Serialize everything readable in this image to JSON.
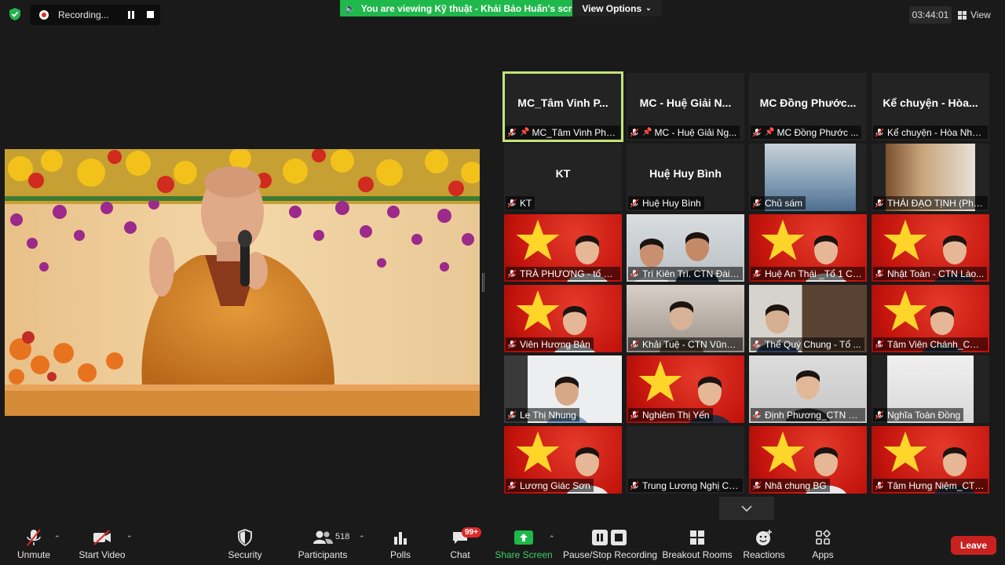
{
  "top": {
    "recording_label": "Recording...",
    "viewing_banner": "You are viewing Kỹ thuật - Khải Bảo Huấn's screen",
    "view_options": "View Options",
    "timer": "03:44:01",
    "view_label": "View"
  },
  "gallery": [
    {
      "big_name": "MC_Tâm Vinh P...",
      "caption": "MC_Tâm Vinh Pho...",
      "pinned": true,
      "active": true,
      "bg": "name"
    },
    {
      "big_name": "MC - Huệ Giải N...",
      "caption": "MC - Huệ Giải Ng...",
      "pinned": true,
      "bg": "name"
    },
    {
      "big_name": "MC Đồng Phước...",
      "caption": "MC Đồng Phước ...",
      "pinned": true,
      "bg": "name"
    },
    {
      "big_name": "Kể chuyện - Hòa...",
      "caption": "Kể chuyện - Hòa Nhã...",
      "bg": "name"
    },
    {
      "big_name": "KT",
      "caption": "KT",
      "bg": "name"
    },
    {
      "big_name": "Huệ Huy Bình",
      "caption": "Huệ Huy Bình",
      "bg": "name"
    },
    {
      "caption": "Chủ sám",
      "bg": "room-blue"
    },
    {
      "caption": "THÁI ĐẠO TỊNH (Phật...",
      "bg": "room-warm"
    },
    {
      "caption": "TRÀ PHƯƠNG - tổ 1 ...",
      "bg": "flag"
    },
    {
      "caption": "Trí Kiên Trì. CTN Đài L...",
      "bg": "office"
    },
    {
      "caption": "Huệ An Thái _Tổ 1 CT...",
      "bg": "flag"
    },
    {
      "caption": "Nhật Toàn - CTN Lào...",
      "bg": "flag"
    },
    {
      "caption": "Viên Hương Bản",
      "bg": "flag"
    },
    {
      "caption": "Khải Tuệ - CTN Vũng ...",
      "bg": "light"
    },
    {
      "caption": "Thể Quý Chung - Tổ ...",
      "bg": "curtain"
    },
    {
      "caption": "Tâm Viên Chánh_CTN...",
      "bg": "flag"
    },
    {
      "caption": "Le Thị Nhung",
      "bg": "dark-room"
    },
    {
      "caption": "Nghiêm Thị Yến",
      "bg": "flag"
    },
    {
      "caption": "Định Phương_CTN H...",
      "bg": "light2"
    },
    {
      "caption": "Nghĩa Toàn Đồng",
      "bg": "white-room"
    },
    {
      "caption": "Lương Giác Sơn",
      "bg": "flag"
    },
    {
      "caption": "Trung Lương Nghị CT...",
      "bg": "dark"
    },
    {
      "caption": "Nhã chung BG",
      "bg": "flag"
    },
    {
      "caption": "Tâm Hưng Niệm_CTN...",
      "bg": "flag"
    }
  ],
  "toolbar": {
    "unmute": "Unmute",
    "start_video": "Start Video",
    "security": "Security",
    "participants": "Participants",
    "participants_count": "518",
    "polls": "Polls",
    "chat": "Chat",
    "chat_badge": "99+",
    "share_screen": "Share Screen",
    "pause_stop_recording": "Pause/Stop Recording",
    "breakout_rooms": "Breakout Rooms",
    "reactions": "Reactions",
    "apps": "Apps",
    "leave": "Leave"
  },
  "colors": {
    "share_green": "#1fb84a",
    "leave_red": "#c8211f",
    "active_speaker": "#c4e27a"
  }
}
